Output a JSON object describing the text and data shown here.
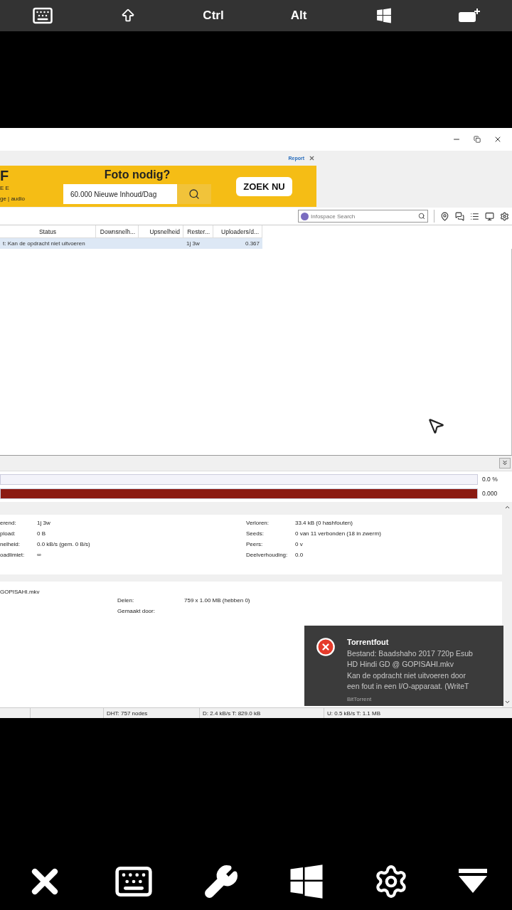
{
  "top_bar": {
    "keys": [
      "Ctrl",
      "Alt"
    ]
  },
  "ad": {
    "report": "Report",
    "fragments": [
      "F",
      "E E",
      "ge | audio"
    ],
    "headline": "Foto nodig?",
    "field_value": "60.000 Nieuwe Inhoud/Dag",
    "cta": "ZOEK NU"
  },
  "search": {
    "placeholder": "Infospace Search"
  },
  "table": {
    "columns": [
      "Status",
      "Downsnelh...",
      "Upsnelheid",
      "Rester...",
      "Uploaders/d..."
    ],
    "rows": [
      {
        "selected": true,
        "cells": [
          "t: Kan de opdracht niet uitvoeren",
          "",
          "",
          "1j 3w",
          "0.367"
        ]
      }
    ]
  },
  "progress": [
    {
      "level": 0,
      "reading": "0.0 %"
    },
    {
      "level": 1,
      "reading": "0.000"
    }
  ],
  "info": {
    "left": [
      {
        "label": "erend:",
        "value": "1j 3w"
      },
      {
        "label": "pload:",
        "value": "0 B"
      },
      {
        "label": "nelheid:",
        "value": "0.0 kB/s (gem. 0 B/s)"
      },
      {
        "label": "oadlimiet:",
        "value": "∞"
      }
    ],
    "right": [
      {
        "label": "Verloren:",
        "value": "33.4 kB (0 hashfouten)"
      },
      {
        "label": "Seeds:",
        "value": "0 van 11 verbonden (18 in zwerm)"
      },
      {
        "label": "Peers:",
        "value": "0 v"
      },
      {
        "label": "Deelverhouding:",
        "value": "0.0"
      }
    ]
  },
  "file": {
    "name": "GOPISAHI.mkv",
    "fields": [
      {
        "label": "Delen:",
        "value": "759 x 1.00 MB (hebben 0)"
      },
      {
        "label": "Gemaakt door:"
      }
    ]
  },
  "status_bar": [
    "DHT: 757 nodes",
    "D: 2.4 kB/s T: 829.0 kB",
    "U: 0.5 kB/s T: 1.1 MB"
  ],
  "toast": {
    "title": "Torrentfout",
    "lines": [
      "Bestand: Baadshaho 2017 720p Esub",
      "HD Hindi GD @ GOPISAHI.mkv",
      "Kan de opdracht niet uitvoeren door",
      "een fout in een I/O-apparaat.  (WriteT"
    ],
    "source": "BitTorrent"
  }
}
